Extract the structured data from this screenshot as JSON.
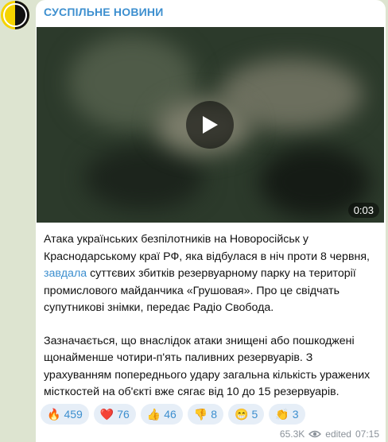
{
  "channel": {
    "name": "СУСПІЛЬНЕ НОВИНИ"
  },
  "video": {
    "duration": "0:03"
  },
  "post": {
    "para1_before": "Атака українських безпілотників на Новоросійськ у Краснодарському краї РФ, яка відбулася в ніч проти 8 червня, ",
    "para1_link": "завдала",
    "para1_after": " суттєвих збитків резервуарному парку на території промислового майданчика «Грушовая». Про це свідчать супутникові знімки, передає Радіо Свобода.",
    "para2": "Зазначається, що внаслідок атаки знищені або пошкоджені щонайменше чотири-п'ять паливних резервуарів. З урахуванням попереднього удару загальна кількість уражених місткостей на об'єкті вже сягає від 10 до 15 резервуарів."
  },
  "reactions": [
    {
      "emoji": "🔥",
      "icon": "fire-icon",
      "count": "459"
    },
    {
      "emoji": "❤️",
      "icon": "heart-icon",
      "count": "76"
    },
    {
      "emoji": "👍",
      "icon": "thumbs-up-icon",
      "count": "46"
    },
    {
      "emoji": "👎",
      "icon": "thumbs-down-icon",
      "count": "8"
    },
    {
      "emoji": "😁",
      "icon": "grin-icon",
      "count": "5"
    },
    {
      "emoji": "👏",
      "icon": "clap-icon",
      "count": "3"
    }
  ],
  "meta": {
    "views": "65.3K",
    "edited_label": "edited",
    "time": "07:15"
  },
  "colors": {
    "accent": "#3d8fcf",
    "background": "#dde4d0"
  }
}
